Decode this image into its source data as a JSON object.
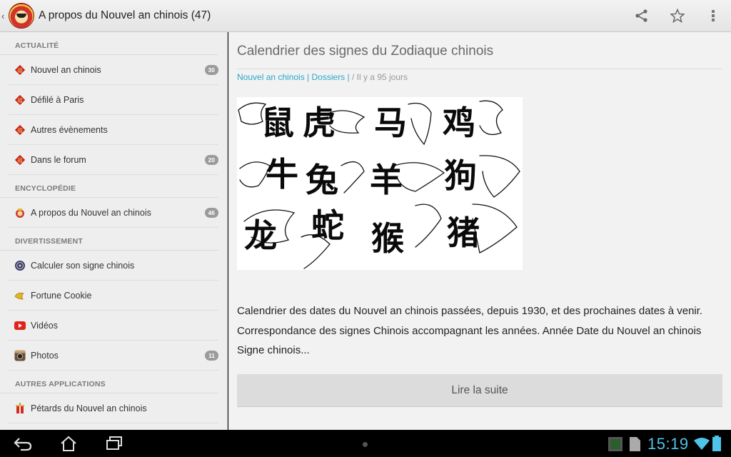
{
  "actionbar": {
    "title": "A propos du Nouvel an chinois (47)",
    "icons": [
      "app-logo",
      "share-icon",
      "star-icon",
      "overflow-menu-icon"
    ]
  },
  "sidebar": {
    "sections": [
      {
        "header": "ACTUALITÉ",
        "items": [
          {
            "label": "Nouvel an chinois",
            "badge": "30",
            "icon": "red-diamond-icon"
          },
          {
            "label": "Défilé à Paris",
            "badge": "",
            "icon": "red-diamond-icon"
          },
          {
            "label": "Autres évènements",
            "badge": "",
            "icon": "red-diamond-icon"
          },
          {
            "label": "Dans le forum",
            "badge": "20",
            "icon": "red-diamond-icon"
          }
        ]
      },
      {
        "header": "ENCYCLOPÉDIE",
        "items": [
          {
            "label": "A propos du Nouvel an chinois",
            "badge": "46",
            "icon": "lion-head-icon"
          }
        ]
      },
      {
        "header": "DIVERTISSEMENT",
        "items": [
          {
            "label": "Calculer son signe chinois",
            "badge": "",
            "icon": "zodiac-wheel-icon"
          },
          {
            "label": "Fortune Cookie",
            "badge": "",
            "icon": "fortune-cookie-icon"
          },
          {
            "label": "Vidéos",
            "badge": "",
            "icon": "video-play-icon"
          },
          {
            "label": "Photos",
            "badge": "11",
            "icon": "camera-icon"
          }
        ]
      },
      {
        "header": "AUTRES APPLICATIONS",
        "items": [
          {
            "label": "Pétards du Nouvel an chinois",
            "badge": "",
            "icon": "firecracker-icon"
          }
        ]
      }
    ]
  },
  "article": {
    "title": "Calendrier des signes du Zodiaque chinois",
    "category_link": "Nouvel an chinois | Dossiers |",
    "date": " / Il y a 95 jours",
    "image_characters": [
      [
        "鼠",
        "虎",
        "马",
        "鸡"
      ],
      [
        "牛",
        "兔",
        "羊",
        "狗"
      ],
      [
        "龙",
        "蛇",
        "猴",
        "猪"
      ]
    ],
    "body": "Calendrier des dates du Nouvel an chinois passées, depuis 1930, et des prochaines dates à venir. Correspondance des signes Chinois accompagnant les années. Année Date du Nouvel an chinois Signe chinois...",
    "read_more": "Lire la suite"
  },
  "systembar": {
    "clock": "15:19",
    "accent_color": "#4fc3e8"
  }
}
